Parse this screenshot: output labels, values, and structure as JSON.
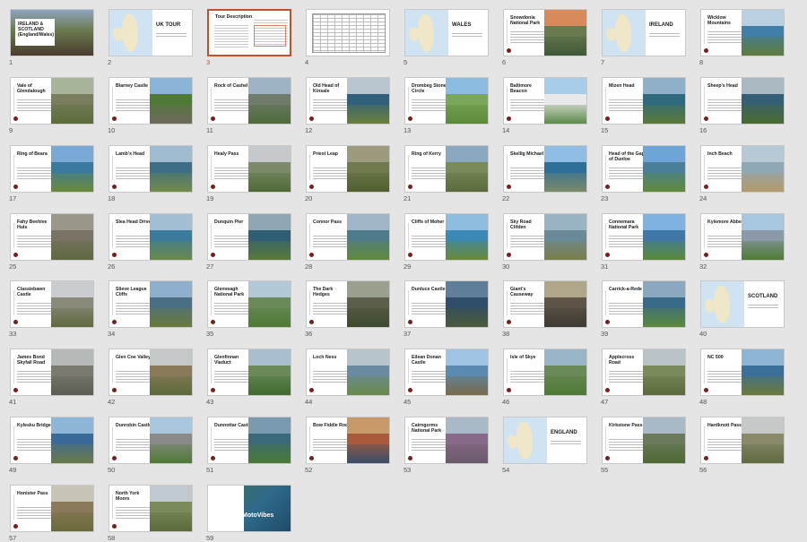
{
  "slides": [
    {
      "num": "1",
      "title": "IRELAND & SCOTLAND (England/Wales)",
      "kind": "cover",
      "colors": [
        "#8ea5c0",
        "#6b7a4e",
        "#4a3c2e"
      ]
    },
    {
      "num": "2",
      "title": "UK TOUR",
      "kind": "map",
      "colors": [
        "#cfe3f3",
        "#efe7c8",
        "#efe7c8"
      ]
    },
    {
      "num": "3",
      "title": "Tour Description",
      "kind": "doc",
      "colors": [
        "#ffffff",
        "#ffffff",
        "#ffffff"
      ]
    },
    {
      "num": "4",
      "title": "",
      "kind": "table",
      "colors": [
        "#ffffff",
        "#ffffff",
        "#ffffff"
      ]
    },
    {
      "num": "5",
      "title": "WALES",
      "kind": "map",
      "colors": [
        "#cfe3f3",
        "#efe7c8",
        "#efe7c8"
      ]
    },
    {
      "num": "6",
      "title": "Snowdonia National Park",
      "kind": "photo",
      "colors": [
        "#d98a5a",
        "#6b7a4e",
        "#3f5a38"
      ]
    },
    {
      "num": "7",
      "title": "IRELAND",
      "kind": "map",
      "colors": [
        "#cfe3f3",
        "#efe7c8",
        "#efe7c8"
      ]
    },
    {
      "num": "8",
      "title": "Wicklow Mountains",
      "kind": "photo",
      "colors": [
        "#b9cfe2",
        "#3f7fa8",
        "#5f7a3a"
      ]
    },
    {
      "num": "9",
      "title": "Vale of Glendalough",
      "kind": "photo",
      "colors": [
        "#a9b59a",
        "#7a7e5e",
        "#5a6b3a"
      ]
    },
    {
      "num": "10",
      "title": "Blarney Castle",
      "kind": "photo",
      "colors": [
        "#8bb5d8",
        "#4f7a35",
        "#6e6a5c"
      ]
    },
    {
      "num": "11",
      "title": "Rock of Cashel",
      "kind": "photo",
      "colors": [
        "#9fb3c6",
        "#6f7c6a",
        "#4e6a3a"
      ]
    },
    {
      "num": "12",
      "title": "Old Head of Kinsale",
      "kind": "photo",
      "colors": [
        "#b9c6cf",
        "#2f5f7a",
        "#6a7e3e"
      ]
    },
    {
      "num": "13",
      "title": "Drombeg Stone Circle",
      "kind": "photo",
      "colors": [
        "#8bbde0",
        "#7aa85a",
        "#5c8a3a"
      ]
    },
    {
      "num": "14",
      "title": "Baltimore Beacon",
      "kind": "photo",
      "colors": [
        "#a9cde8",
        "#e9e9e9",
        "#5e8a4a"
      ]
    },
    {
      "num": "15",
      "title": "Mizen Head",
      "kind": "photo",
      "colors": [
        "#8fb0c8",
        "#2d6a7e",
        "#5a7a3a"
      ]
    },
    {
      "num": "16",
      "title": "Sheep's Head",
      "kind": "photo",
      "colors": [
        "#aab9c2",
        "#355f74",
        "#4a6a32"
      ]
    },
    {
      "num": "17",
      "title": "Ring of Beara",
      "kind": "photo",
      "colors": [
        "#79a9d6",
        "#3a7aa0",
        "#6a8a3a"
      ]
    },
    {
      "num": "18",
      "title": "Lamb's Head",
      "kind": "photo",
      "colors": [
        "#9fbbd0",
        "#3d6e85",
        "#738a4a"
      ]
    },
    {
      "num": "19",
      "title": "Healy Pass",
      "kind": "photo",
      "colors": [
        "#c5c9cc",
        "#7c8a6a",
        "#4f6a35"
      ]
    },
    {
      "num": "20",
      "title": "Priest Leap",
      "kind": "photo",
      "colors": [
        "#9e9a7e",
        "#6f7a4e",
        "#4f5e30"
      ]
    },
    {
      "num": "21",
      "title": "Ring of Kerry",
      "kind": "photo",
      "colors": [
        "#8aa8c0",
        "#7a8a5a",
        "#5a6a3a"
      ]
    },
    {
      "num": "22",
      "title": "Skellig Michael",
      "kind": "photo",
      "colors": [
        "#8fbde3",
        "#2e6f9a",
        "#7a8a6a"
      ]
    },
    {
      "num": "23",
      "title": "Head of the Gap of Dunloe",
      "kind": "photo",
      "colors": [
        "#6fa4d8",
        "#4a7f9a",
        "#5e8a3a"
      ]
    },
    {
      "num": "24",
      "title": "Inch Beach",
      "kind": "photo",
      "colors": [
        "#b8c9d6",
        "#8fa8b5",
        "#b39a6a"
      ]
    },
    {
      "num": "25",
      "title": "Fahy Beehive Huts",
      "kind": "photo",
      "colors": [
        "#9a968a",
        "#7a7264",
        "#5e6a40"
      ]
    },
    {
      "num": "26",
      "title": "Slea Head Drive",
      "kind": "photo",
      "colors": [
        "#a3bfd4",
        "#3a7a9a",
        "#6a8a4a"
      ]
    },
    {
      "num": "27",
      "title": "Dunquin Pier",
      "kind": "photo",
      "colors": [
        "#8fa6b5",
        "#2f5e72",
        "#5a7a3a"
      ]
    },
    {
      "num": "28",
      "title": "Connor Pass",
      "kind": "photo",
      "colors": [
        "#9fb5c8",
        "#4f7a8a",
        "#5f8a3e"
      ]
    },
    {
      "num": "29",
      "title": "Cliffs of Moher",
      "kind": "photo",
      "colors": [
        "#8fbddf",
        "#3a8ab5",
        "#6a8a3a"
      ]
    },
    {
      "num": "30",
      "title": "Sky Road Clifden",
      "kind": "photo",
      "colors": [
        "#9ab3c5",
        "#6a8a9a",
        "#7a7e4a"
      ]
    },
    {
      "num": "31",
      "title": "Connemara National Park",
      "kind": "photo",
      "colors": [
        "#7fb2e0",
        "#3f78a8",
        "#5a8a3a"
      ]
    },
    {
      "num": "32",
      "title": "Kylemore Abbey",
      "kind": "photo",
      "colors": [
        "#a7c6e0",
        "#8a9aa8",
        "#4f7a35"
      ]
    },
    {
      "num": "33",
      "title": "Classiebawn Castle",
      "kind": "photo",
      "colors": [
        "#c9cdd0",
        "#8a8a7a",
        "#5f6a40"
      ]
    },
    {
      "num": "34",
      "title": "Slieve League Cliffs",
      "kind": "photo",
      "colors": [
        "#8fb0cc",
        "#4a6f85",
        "#6a7a3a"
      ]
    },
    {
      "num": "35",
      "title": "Glenveagh National Park",
      "kind": "photo",
      "colors": [
        "#b3c9d8",
        "#6a8a5a",
        "#4f7a35"
      ]
    },
    {
      "num": "36",
      "title": "The Dark Hedges",
      "kind": "photo",
      "colors": [
        "#9aa08e",
        "#5a5e4a",
        "#3e4a2e"
      ]
    },
    {
      "num": "37",
      "title": "Dunluce Castle",
      "kind": "photo",
      "colors": [
        "#5f7e9a",
        "#2e4e6a",
        "#4a5a3a"
      ]
    },
    {
      "num": "38",
      "title": "Giant's Causeway",
      "kind": "photo",
      "colors": [
        "#b0a68a",
        "#5e5448",
        "#3e3a32"
      ]
    },
    {
      "num": "39",
      "title": "Carrick-a-Rede",
      "kind": "photo",
      "colors": [
        "#8aa8c0",
        "#3a6a8a",
        "#5a8a3a"
      ]
    },
    {
      "num": "40",
      "title": "SCOTLAND",
      "kind": "map",
      "colors": [
        "#cfe3f3",
        "#efe7c8",
        "#efe7c8"
      ]
    },
    {
      "num": "41",
      "title": "James Bond Skyfall Road",
      "kind": "photo",
      "colors": [
        "#b5b9b8",
        "#7a7a6e",
        "#5a5e50"
      ]
    },
    {
      "num": "42",
      "title": "Glen Coe Valley",
      "kind": "photo",
      "colors": [
        "#c4c8c8",
        "#8a7a5a",
        "#5a6a3a"
      ]
    },
    {
      "num": "43",
      "title": "Glenfinnan Viaduct",
      "kind": "photo",
      "colors": [
        "#a9bfcf",
        "#6a8a5a",
        "#3f6a2e"
      ]
    },
    {
      "num": "44",
      "title": "Loch Ness",
      "kind": "photo",
      "colors": [
        "#b7c4cc",
        "#6a8aa0",
        "#6a8a4a"
      ]
    },
    {
      "num": "45",
      "title": "Eilean Donan Castle",
      "kind": "photo",
      "colors": [
        "#9fc3e2",
        "#5a8ab0",
        "#7a6a4a"
      ]
    },
    {
      "num": "46",
      "title": "Isle of Skye",
      "kind": "photo",
      "colors": [
        "#9ab5c8",
        "#6a8a5a",
        "#4f7a35"
      ]
    },
    {
      "num": "47",
      "title": "Applecross Road",
      "kind": "photo",
      "colors": [
        "#b9c3c8",
        "#7a8a5a",
        "#5a6a3a"
      ]
    },
    {
      "num": "48",
      "title": "NC 500",
      "kind": "photo",
      "colors": [
        "#8fb5d6",
        "#3a6f9a",
        "#6a7a3a"
      ]
    },
    {
      "num": "49",
      "title": "Kylesku Bridge",
      "kind": "photo",
      "colors": [
        "#8eb6d8",
        "#3a6a9a",
        "#6a7a4a"
      ]
    },
    {
      "num": "50",
      "title": "Dunrobin Castle",
      "kind": "photo",
      "colors": [
        "#a9c6df",
        "#8a8a8a",
        "#4f7a35"
      ]
    },
    {
      "num": "51",
      "title": "Dunnottar Castle",
      "kind": "photo",
      "colors": [
        "#7a9ab0",
        "#3a6a7a",
        "#4a7a35"
      ]
    },
    {
      "num": "52",
      "title": "Bow Fiddle Rock",
      "kind": "photo",
      "colors": [
        "#c89a6a",
        "#a85a3a",
        "#3a4e6a"
      ]
    },
    {
      "num": "53",
      "title": "Cairngorms National Park",
      "kind": "photo",
      "colors": [
        "#aab9c8",
        "#8a6a8a",
        "#6a5a6a"
      ]
    },
    {
      "num": "54",
      "title": "ENGLAND",
      "kind": "map",
      "colors": [
        "#cfe3f3",
        "#efe7c8",
        "#efe7c8"
      ]
    },
    {
      "num": "55",
      "title": "Kirkstone Pass",
      "kind": "photo",
      "colors": [
        "#a9b9c6",
        "#6a7a5a",
        "#4f6a35"
      ]
    },
    {
      "num": "56",
      "title": "Hardknott Pass",
      "kind": "photo",
      "colors": [
        "#c6c9c8",
        "#8a8a6a",
        "#5f6a40"
      ]
    },
    {
      "num": "57",
      "title": "Honister Pass",
      "kind": "photo",
      "colors": [
        "#c8c4b8",
        "#8a7a5a",
        "#6a6a3a"
      ]
    },
    {
      "num": "58",
      "title": "North York Moors",
      "kind": "photo",
      "colors": [
        "#bfc9cf",
        "#7a8a5a",
        "#5a6a3a"
      ]
    },
    {
      "num": "59",
      "title": "MotoVibes",
      "kind": "end",
      "colors": [
        "#3f6f5a",
        "#2f6a8a",
        "#1f4a6a"
      ]
    }
  ]
}
